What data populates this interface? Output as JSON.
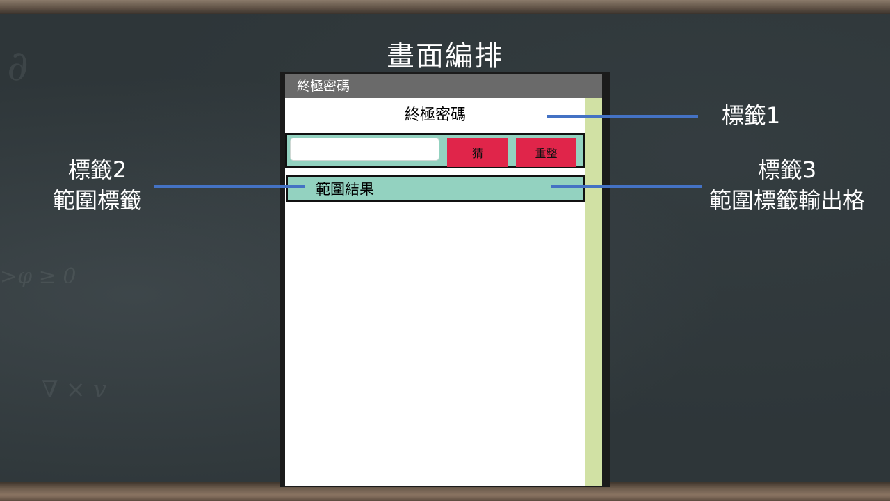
{
  "slide": {
    "title": "畫面編排",
    "labels": {
      "label1": "標籤1",
      "label2_line1": "標籤2",
      "label2_line2": "範圍標籤",
      "label3_line1": "標籤3",
      "label3_line2": "範圍標籤輸出格"
    },
    "connector_color": "#4472c4"
  },
  "app": {
    "window_title": "終極密碼",
    "header_label": "終極密碼",
    "guess_input": {
      "value": "",
      "placeholder": ""
    },
    "guess_button": "猜",
    "reset_button": "重整",
    "range_result": "範圍結果",
    "colors": {
      "titlebar": "#6a6a6a",
      "row_background": "#93d2c0",
      "button": "#e0254a",
      "sidebar": "#d1e1a4"
    }
  }
}
